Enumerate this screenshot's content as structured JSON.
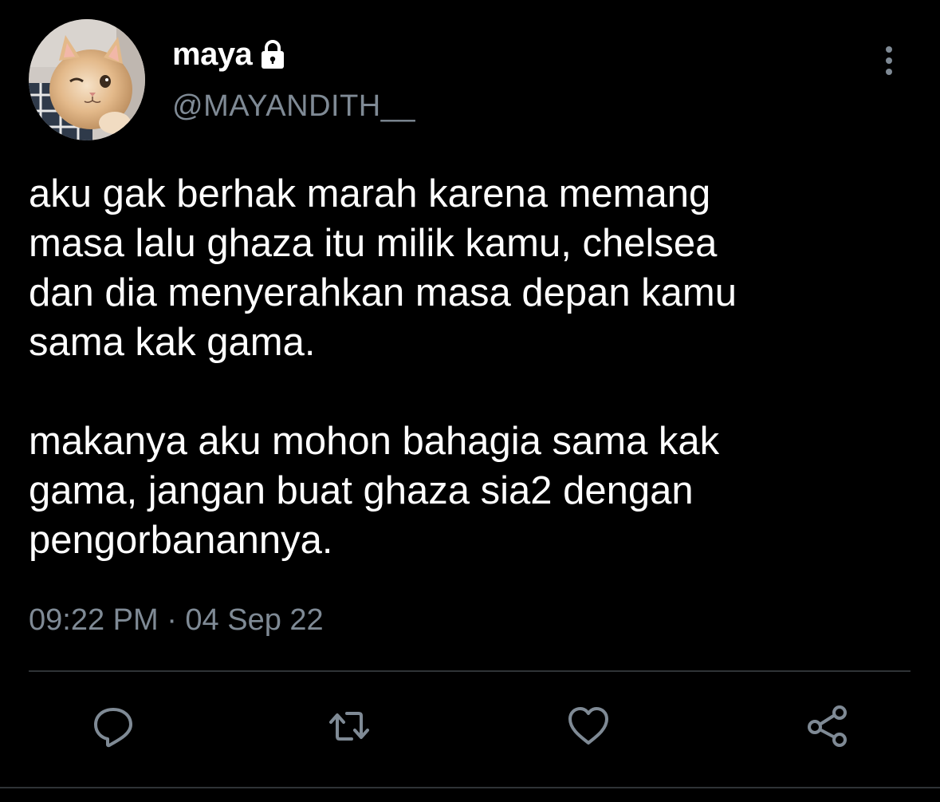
{
  "tweet": {
    "display_name": "maya",
    "handle": "@MAYANDITH__",
    "paragraphs": [
      "aku gak berhak marah karena memang\nmasa lalu ghaza itu milik kamu, chelsea\ndan dia menyerahkan masa depan kamu\nsama kak gama.",
      "makanya aku mohon bahagia sama kak\ngama, jangan buat ghaza sia2 dengan\npengorbanannya."
    ],
    "timestamp": "09:22 PM · 04 Sep 22",
    "icons": {
      "lock": "lock-icon",
      "more": "more-vertical-icon",
      "reply": "reply-icon",
      "retweet": "retweet-icon",
      "like": "heart-icon",
      "share": "share-icon"
    }
  },
  "colors": {
    "background": "#000000",
    "text": "#ffffff",
    "muted": "#7f8a95",
    "divider": "#2f3336"
  }
}
